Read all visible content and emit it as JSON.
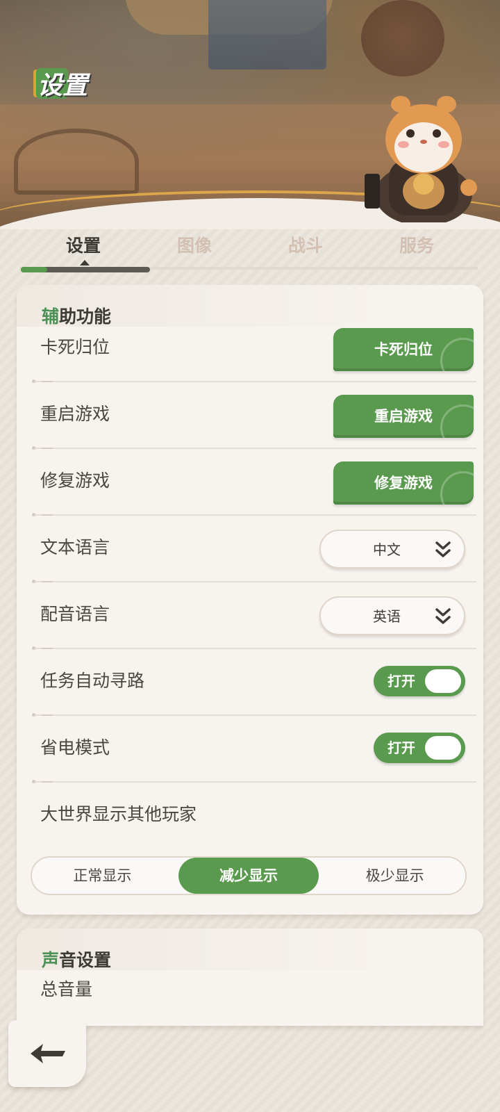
{
  "header": {
    "title": "设置"
  },
  "tabs": [
    {
      "label": "设置",
      "active": true
    },
    {
      "label": "图像",
      "active": false
    },
    {
      "label": "战斗",
      "active": false
    },
    {
      "label": "服务",
      "active": false
    }
  ],
  "accessibility": {
    "title_accent": "辅",
    "title_rest": "助功能",
    "rows": [
      {
        "label": "卡死归位",
        "button": "卡死归位"
      },
      {
        "label": "重启游戏",
        "button": "重启游戏"
      },
      {
        "label": "修复游戏",
        "button": "修复游戏"
      },
      {
        "label": "文本语言",
        "dropdown": "中文"
      },
      {
        "label": "配音语言",
        "dropdown": "英语"
      },
      {
        "label": "任务自动寻路",
        "toggle": "打开"
      },
      {
        "label": "省电模式",
        "toggle": "打开"
      },
      {
        "label": "大世界显示其他玩家"
      }
    ],
    "player_display": {
      "options": [
        "正常显示",
        "减少显示",
        "极少显示"
      ],
      "selected": "减少显示"
    }
  },
  "sound": {
    "title_accent": "声",
    "title_rest": "音设置",
    "first_row": "总音量"
  },
  "colors": {
    "accent_green": "#5a9a4f",
    "card_bg": "#f7f3ef",
    "text_dark": "#3e3a34"
  }
}
